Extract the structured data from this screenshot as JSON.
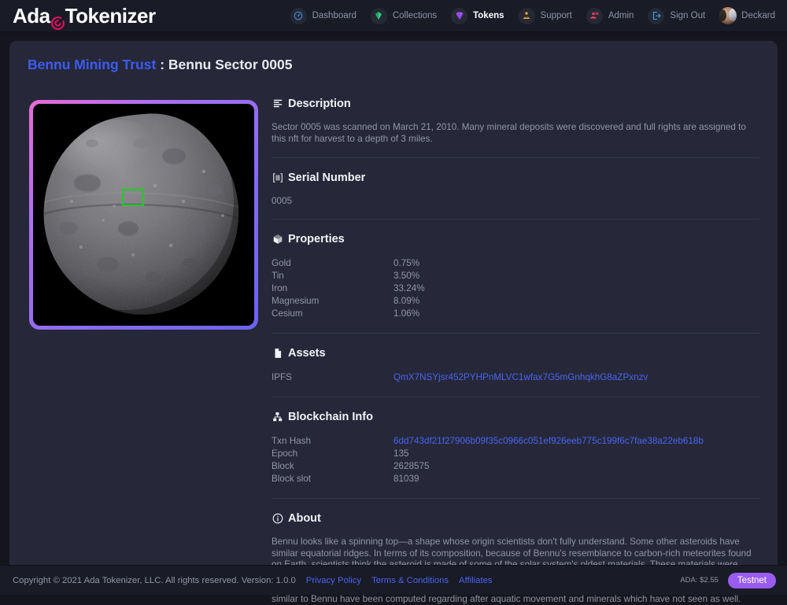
{
  "brand": {
    "text_a": "Ada",
    "text_b": "Tokenizer",
    "mark": "target-icon",
    "accent": "#e0115f"
  },
  "nav": {
    "items": [
      {
        "label": "Dashboard",
        "icon": "gauge-icon",
        "color": "#4a8fe0",
        "active": false
      },
      {
        "label": "Collections",
        "icon": "gem-icon",
        "color": "#2fd07a",
        "active": false
      },
      {
        "label": "Tokens",
        "icon": "diamond-icon",
        "color": "#a855f7",
        "active": true
      },
      {
        "label": "Support",
        "icon": "lifebuoy-icon",
        "color": "#f0a030",
        "active": false
      },
      {
        "label": "Admin",
        "icon": "user-gear-icon",
        "color": "#ef4060",
        "active": false
      },
      {
        "label": "Sign Out",
        "icon": "sign-out-icon",
        "color": "#3aa8e0",
        "active": false
      }
    ],
    "user": {
      "name": "Deckard",
      "avatar": "user-avatar"
    }
  },
  "page": {
    "collection": "Bennu Mining Trust",
    "separator": " : ",
    "token_name": "Bennu Sector 0005"
  },
  "media": {
    "alt": "asteroid-bennu-render",
    "border_gradient_from": "#e86bd4",
    "border_gradient_to": "#6b63ee",
    "sector_highlight_color": "#24c924"
  },
  "sections": {
    "description": {
      "title": "Description",
      "icon": "document-lines-icon",
      "text": "Sector 0005 was scanned on March 21, 2010. Many mineral deposits were discovered and full rights are assigned to this nft for harvest to a depth of 3 miles."
    },
    "serial": {
      "title": "Serial Number",
      "icon": "barcode-icon",
      "value": "0005"
    },
    "properties": {
      "title": "Properties",
      "icon": "cube-icon",
      "rows": [
        {
          "key": "Gold",
          "value": "0.75%"
        },
        {
          "key": "Tin",
          "value": "3.50%"
        },
        {
          "key": "Iron",
          "value": "33.24%"
        },
        {
          "key": "Magnesium",
          "value": "8.09%"
        },
        {
          "key": "Cesium",
          "value": "1.06%"
        }
      ]
    },
    "assets": {
      "title": "Assets",
      "icon": "file-icon",
      "rows": [
        {
          "key": "IPFS",
          "value": "QmX7NSYjsr452PYHPnMLVC1wfax7G5mGnhqkhG8aZPxnzv",
          "link": true
        }
      ]
    },
    "blockchain": {
      "title": "Blockchain Info",
      "icon": "sitemap-icon",
      "rows": [
        {
          "key": "Txn Hash",
          "value": "6dd743df21f27906b09f35c0966c051ef926eeb775c199f6c7fae38a22eb618b",
          "link": true
        },
        {
          "key": "Epoch",
          "value": "135",
          "link": false
        },
        {
          "key": "Block",
          "value": "2628575",
          "link": false
        },
        {
          "key": "Block slot",
          "value": "81039",
          "link": false
        }
      ]
    },
    "about": {
      "title": "About",
      "icon": "info-circle-icon",
      "text": "Bennu looks like a spinning top—a shape whose origin scientists don't fully understand. Some other asteroids have similar equatorial ridges. In terms of its composition, because of Bennu's resemblance to carbon-rich meteorites found on Earth, scientists think the asteroid is made of some of the solar system's oldest materials. These materials were forged in large dying stars, including supernova explosions, long before our solar system formed. The asteroid's materials would have been altered by heat when its parent body broke apart in the giant collision. Meteorites that are similar to Bennu have been computed regarding after aquatic movement and minerals which have not seen as well."
    }
  },
  "footer": {
    "copyright": "Copyright © 2021 Ada Tokenizer, LLC. All rights reserved. Version: 1.0.0",
    "links": [
      "Privacy Policy",
      "Terms & Conditions",
      "Affiliates"
    ],
    "ada_price": "ADA: $2.55",
    "network_badge": "Testnet"
  }
}
